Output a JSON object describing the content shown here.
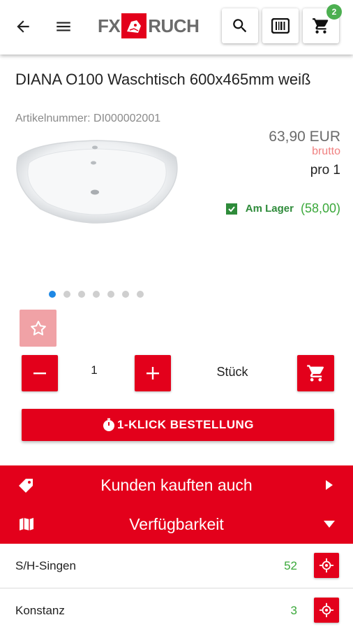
{
  "header": {
    "logo_left": "FX",
    "logo_right": "RUCH",
    "cart_count": "2"
  },
  "product": {
    "title": "DIANA O100 Waschtisch 600x465mm weiß",
    "article_number": "Artikelnummer: DI000002001",
    "price": "63,90 EUR",
    "price_note": "brutto",
    "per_unit": "pro 1",
    "stock_label": "Am Lager",
    "stock_qty": "(58,00)",
    "gallery_count": 7,
    "gallery_active": 0
  },
  "order": {
    "quantity": "1",
    "unit": "Stück",
    "one_click_label": "1-KLICK BESTELLUNG"
  },
  "sections": {
    "customers_also_bought": "Kunden kauften auch",
    "availability": "Verfügbarkeit"
  },
  "locations": [
    {
      "name": "S/H-Singen",
      "count": "52"
    },
    {
      "name": "Konstanz",
      "count": "3"
    }
  ],
  "colors": {
    "brand_red": "#e3001b",
    "stock_green": "#2e8b3a",
    "badge_green": "#4caf50",
    "active_dot": "#1e88e5"
  }
}
